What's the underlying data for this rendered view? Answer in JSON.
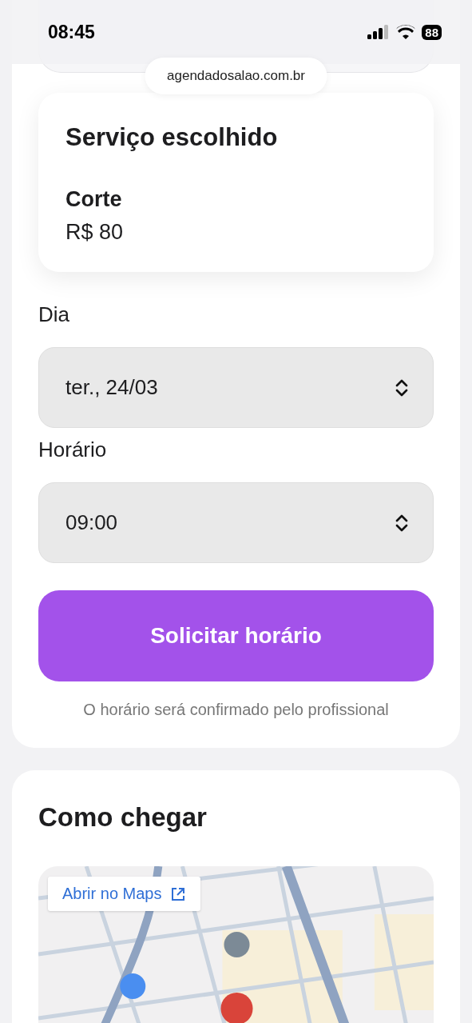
{
  "status_bar": {
    "time": "08:45",
    "battery": "88"
  },
  "url_bar": {
    "address": "agendadosalao.com.br"
  },
  "service_card": {
    "title": "Serviço escolhido",
    "service": "Corte",
    "price": "R$ 80"
  },
  "fields": [
    {
      "label": "Dia",
      "value": "ter., 24/03"
    },
    {
      "label": "Horário",
      "value": "09:00"
    }
  ],
  "submit_button": "Solicitar horário",
  "note": "O horário será confirmado pelo profissional",
  "directions": {
    "title": "Como chegar",
    "open_maps_button": "Abrir no Maps"
  }
}
